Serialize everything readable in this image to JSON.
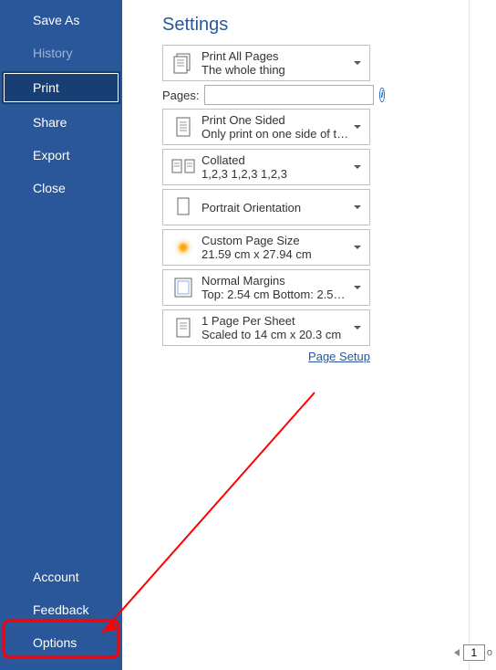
{
  "sidebar": {
    "items": {
      "saveas": "Save As",
      "history": "History",
      "print": "Print",
      "share": "Share",
      "export": "Export",
      "close": "Close",
      "account": "Account",
      "feedback": "Feedback",
      "options": "Options"
    }
  },
  "settings": {
    "title": "Settings",
    "printAll": {
      "title": "Print All Pages",
      "sub": "The whole thing"
    },
    "pagesLabel": "Pages:",
    "pagesValue": "",
    "printOneSided": {
      "title": "Print One Sided",
      "sub": "Only print on one side of th..."
    },
    "collated": {
      "title": "Collated",
      "sub": "1,2,3    1,2,3    1,2,3"
    },
    "orientation": {
      "title": "Portrait Orientation",
      "sub": ""
    },
    "pageSize": {
      "title": "Custom Page Size",
      "sub": "21.59 cm x 27.94 cm"
    },
    "margins": {
      "title": "Normal Margins",
      "sub": "Top: 2.54 cm Bottom: 2.54 c..."
    },
    "perSheet": {
      "title": "1 Page Per Sheet",
      "sub": "Scaled to 14 cm x 20.3 cm"
    },
    "pageSetup": "Page Setup"
  },
  "preview": {
    "currentPage": "1",
    "ofLabel": "o"
  }
}
